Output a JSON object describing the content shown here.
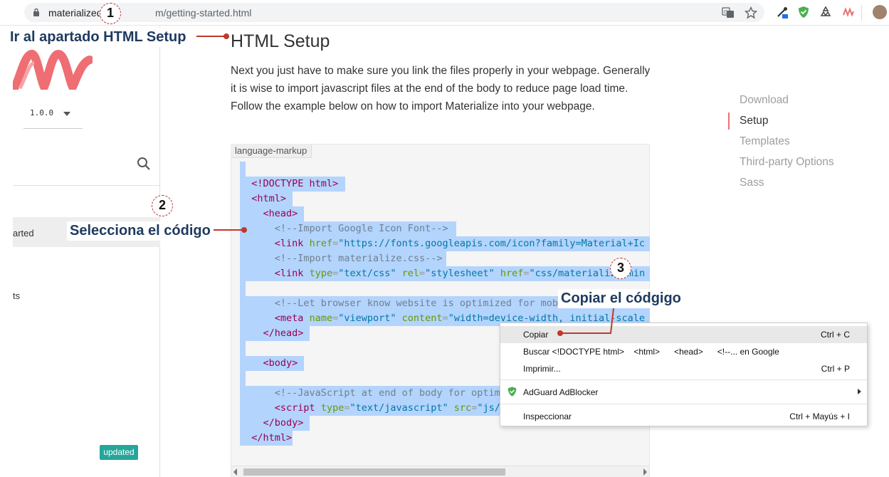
{
  "browser": {
    "url_host": "materialized",
    "url_path": "m/getting-started.html"
  },
  "sidebar": {
    "version": "1.0.0",
    "nav_started": "arted",
    "nav_ts": "ts",
    "updated_badge": "updated"
  },
  "main": {
    "title": "HTML Setup",
    "intro": "Next you just have to make sure you link the files properly in your webpage. Generally it is wise to import javascript files at the end of the body to reduce page load time. Follow the example below on how to import Materialize into your webpage.",
    "code_language": "language-markup"
  },
  "toc": {
    "items": [
      "Download",
      "Setup",
      "Templates",
      "Third-party Options",
      "Sass"
    ],
    "active": "Setup"
  },
  "context_menu": {
    "items": [
      {
        "label": "Copiar",
        "shortcut": "Ctrl + C"
      },
      {
        "label": "Buscar <!DOCTYPE html>    <html>      <head>      <!--... en Google",
        "shortcut": ""
      },
      {
        "label": "Imprimir...",
        "shortcut": "Ctrl + P"
      },
      {
        "label": "AdGuard AdBlocker",
        "shortcut": ""
      },
      {
        "label": "Inspeccionar",
        "shortcut": "Ctrl + Mayús + I"
      }
    ]
  },
  "annotations": {
    "step1": {
      "number": "1",
      "text": "Ir al apartado HTML Setup"
    },
    "step2": {
      "number": "2",
      "text": "Selecciona el código"
    },
    "step3": {
      "number": "3",
      "text": "Copiar el códgigo"
    }
  },
  "colors": {
    "accent": "#ee6e73",
    "badge": "#26a69a",
    "selection": "#b3d4fc",
    "annotation_text": "#1e3a5f",
    "annotation_line": "#c0392b"
  }
}
